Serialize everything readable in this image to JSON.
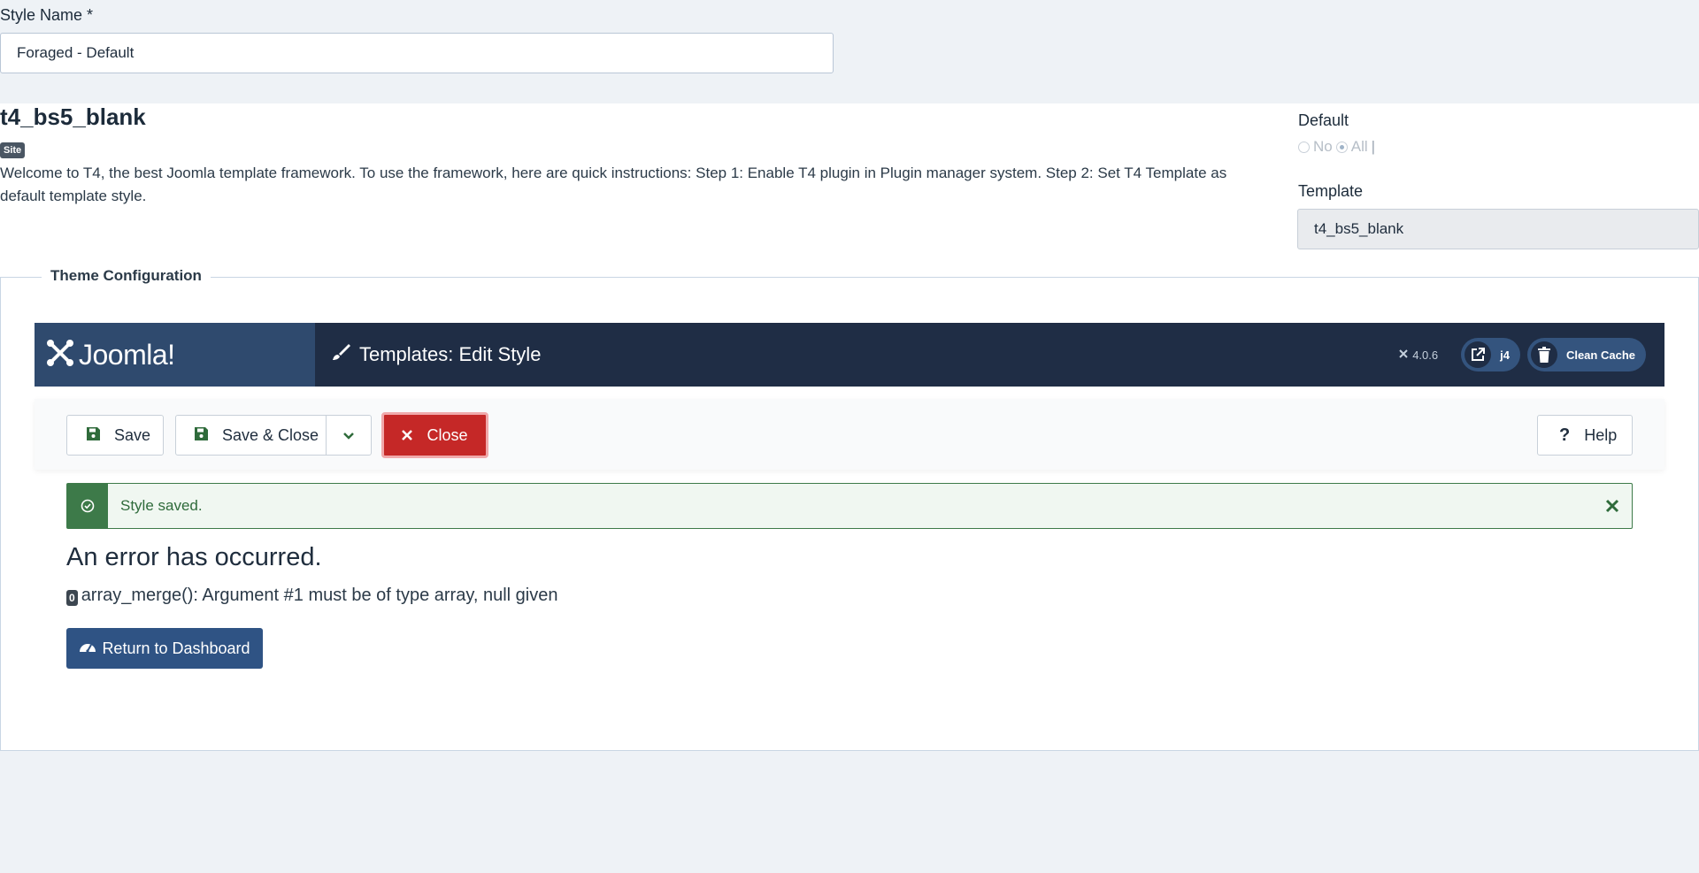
{
  "style_name": {
    "label": "Style Name *",
    "value": "Foraged - Default"
  },
  "template_info": {
    "name": "t4_bs5_blank",
    "badge": "Site",
    "description": "Welcome to T4, the best Joomla template framework. To use the framework, here are quick instructions: Step 1: Enable T4 plugin in Plugin manager system. Step 2: Set T4 Template as default template style."
  },
  "default_field": {
    "label": "Default",
    "options": [
      "No",
      "All"
    ],
    "selected": "All"
  },
  "template_field": {
    "label": "Template",
    "value": "t4_bs5_blank"
  },
  "theme_config": {
    "legend": "Theme Configuration"
  },
  "header": {
    "logo_text": "Joomla!",
    "page_title": "Templates: Edit Style",
    "version": "4.0.6",
    "site_link_label": "j4",
    "clean_cache_label": "Clean Cache"
  },
  "toolbar": {
    "save_label": "Save",
    "save_close_label": "Save & Close",
    "close_label": "Close",
    "help_label": "Help"
  },
  "alert": {
    "message": "Style saved."
  },
  "error": {
    "title": "An error has occurred.",
    "code": "0",
    "message": "array_merge(): Argument #1 must be of type array, null given",
    "button_label": "Return to Dashboard"
  },
  "colors": {
    "page_bg": "#eef2f6",
    "header_bg": "#1f2d45",
    "logo_bg": "#2f4a6e",
    "close_red": "#c52827",
    "success_green": "#3d7a49",
    "dashboard_blue": "#2f5384"
  },
  "icons": [
    "joomla-logo-icon",
    "brush-icon",
    "joomla-small-icon",
    "external-link-icon",
    "trash-icon",
    "floppy-disk-icon",
    "chevron-down-icon",
    "x-icon",
    "question-icon",
    "check-circle-icon",
    "close-icon",
    "dashboard-icon"
  ]
}
